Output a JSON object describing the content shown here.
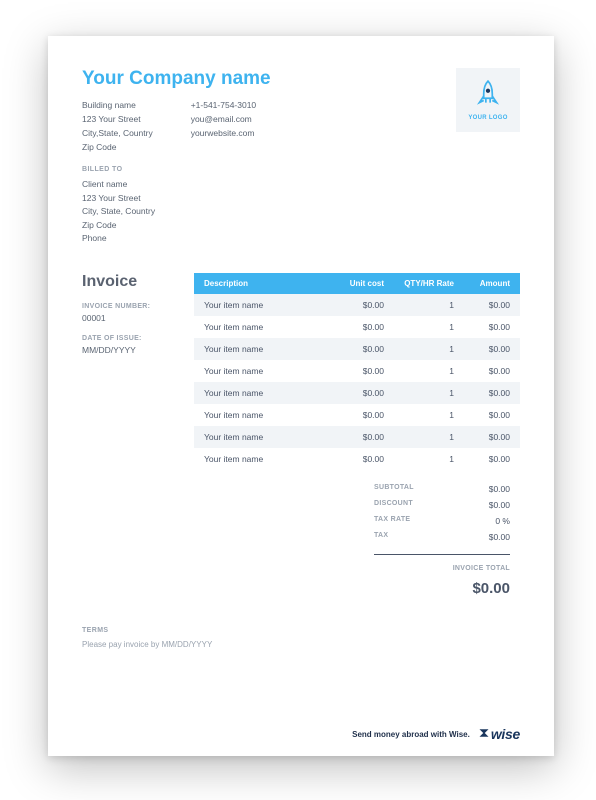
{
  "company": {
    "name": "Your Company name",
    "address": {
      "building": "Building name",
      "street": "123 Your Street",
      "city_state_country": "City,State, Country",
      "zip": "Zip Code"
    },
    "contact": {
      "phone": "+1-541-754-3010",
      "email": "you@email.com",
      "website": "yourwebsite.com"
    },
    "logo_caption": "YOUR LOGO"
  },
  "labels": {
    "billed_to": "BILLED TO",
    "invoice_heading": "Invoice",
    "invoice_number_label": "INVOICE NUMBER:",
    "date_of_issue_label": "DATE OF ISSUE:",
    "terms_heading": "TERMS",
    "subtotal": "SUBTOTAL",
    "discount": "DISCOUNT",
    "tax_rate": "TAX RATE",
    "tax": "TAX",
    "invoice_total": "INVOICE TOTAL",
    "col_description": "Description",
    "col_unit_cost": "Unit cost",
    "col_qty": "QTY/HR Rate",
    "col_amount": "Amount"
  },
  "billed_to": {
    "name": "Client name",
    "street": "123 Your Street",
    "city_state_country": "City, State, Country",
    "zip": "Zip Code",
    "phone": "Phone"
  },
  "invoice": {
    "number": "00001",
    "date_of_issue": "MM/DD/YYYY"
  },
  "line_items": [
    {
      "description": "Your item name",
      "unit_cost": "$0.00",
      "qty": "1",
      "amount": "$0.00"
    },
    {
      "description": "Your item name",
      "unit_cost": "$0.00",
      "qty": "1",
      "amount": "$0.00"
    },
    {
      "description": "Your item name",
      "unit_cost": "$0.00",
      "qty": "1",
      "amount": "$0.00"
    },
    {
      "description": "Your item name",
      "unit_cost": "$0.00",
      "qty": "1",
      "amount": "$0.00"
    },
    {
      "description": "Your item name",
      "unit_cost": "$0.00",
      "qty": "1",
      "amount": "$0.00"
    },
    {
      "description": "Your item name",
      "unit_cost": "$0.00",
      "qty": "1",
      "amount": "$0.00"
    },
    {
      "description": "Your item name",
      "unit_cost": "$0.00",
      "qty": "1",
      "amount": "$0.00"
    },
    {
      "description": "Your item name",
      "unit_cost": "$0.00",
      "qty": "1",
      "amount": "$0.00"
    }
  ],
  "totals": {
    "subtotal": "$0.00",
    "discount": "$0.00",
    "tax_rate": "0 %",
    "tax": "$0.00",
    "invoice_total": "$0.00"
  },
  "terms": {
    "text": "Please pay invoice by MM/DD/YYYY"
  },
  "footer": {
    "tagline": "Send money abroad with Wise.",
    "brand": "wise"
  }
}
